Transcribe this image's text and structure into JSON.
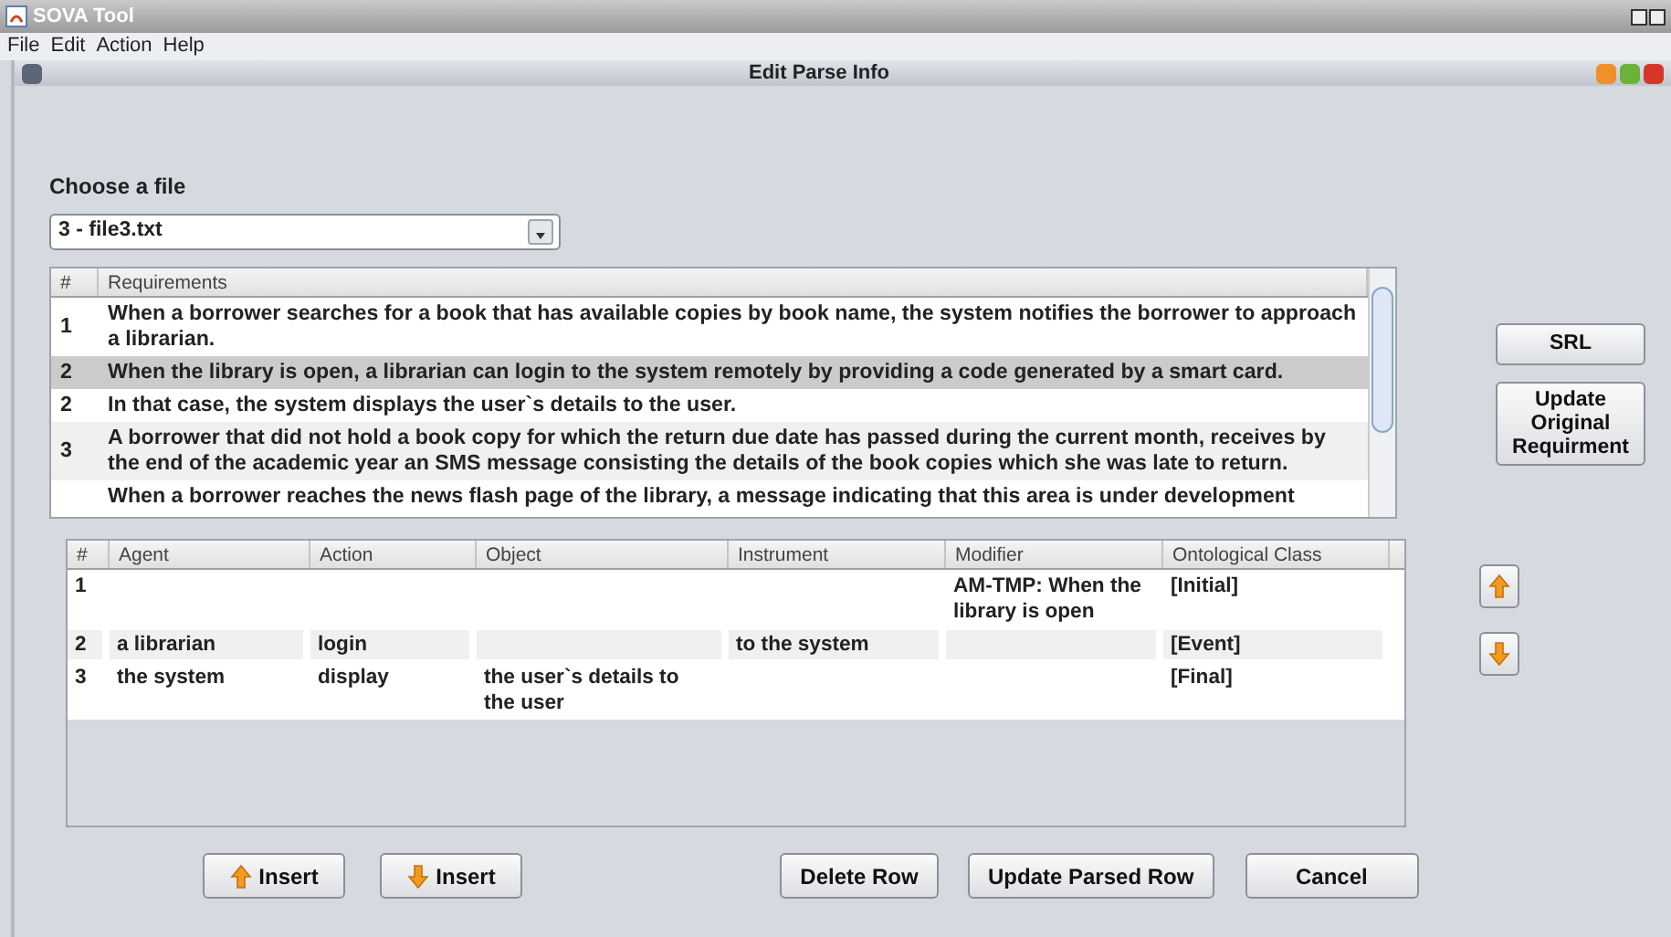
{
  "app": {
    "title": "SOVA Tool",
    "menu": [
      "File",
      "Edit",
      "Action",
      "Help"
    ]
  },
  "dialog": {
    "title": "Edit Parse Info"
  },
  "file_chooser": {
    "label": "Choose a file",
    "value": "3 - file3.txt"
  },
  "requirements": {
    "columns": [
      "#",
      "Requirements"
    ],
    "rows": [
      {
        "number": "1",
        "text": "When a borrower searches for a book that has available copies by book name, the system notifies the borrower to approach a librarian.",
        "selected": false
      },
      {
        "number": "2",
        "text": "When the library is open, a librarian can login to the system remotely by providing a code generated by a smart card.",
        "selected": true
      },
      {
        "number": "2",
        "text": "In that case, the system displays the user`s details to the user.",
        "selected": false
      },
      {
        "number": "3",
        "text": "A borrower that did not hold a book copy for which the return due date has passed during the current month, receives by the end of the academic year an SMS message consisting the details of the book copies which she was late to return.",
        "selected": false
      },
      {
        "number": "",
        "text": "When a borrower reaches the news flash page of the library, a message indicating that this area is under development",
        "selected": false
      }
    ]
  },
  "side_buttons": [
    "SRL",
    "Update Original Requirment"
  ],
  "move_buttons": [
    {
      "kind": "up"
    },
    {
      "kind": "down"
    }
  ],
  "parse_table": {
    "columns": [
      "#",
      "Agent",
      "Action",
      "Object",
      "Instrument",
      "Modifier",
      "Ontological Class"
    ],
    "rows": [
      {
        "cells": [
          "1",
          null,
          null,
          null,
          null,
          "AM-TMP: When the library is open",
          "[Initial]"
        ]
      },
      {
        "cells": [
          "2",
          "a librarian",
          "login",
          null,
          "to the system",
          null,
          "[Event]"
        ]
      },
      {
        "cells": [
          "3",
          "the system",
          "display",
          "the user`s details to the user",
          null,
          null,
          "[Final]"
        ]
      }
    ]
  },
  "bottom_buttons": [
    {
      "kind": "up",
      "label": "Insert"
    },
    {
      "kind": "down",
      "label": "Insert"
    },
    {
      "kind": "plain",
      "label": "Delete Row"
    },
    {
      "kind": "plain",
      "label": "Update Parsed Row"
    },
    {
      "kind": "plain",
      "label": "Cancel"
    }
  ]
}
